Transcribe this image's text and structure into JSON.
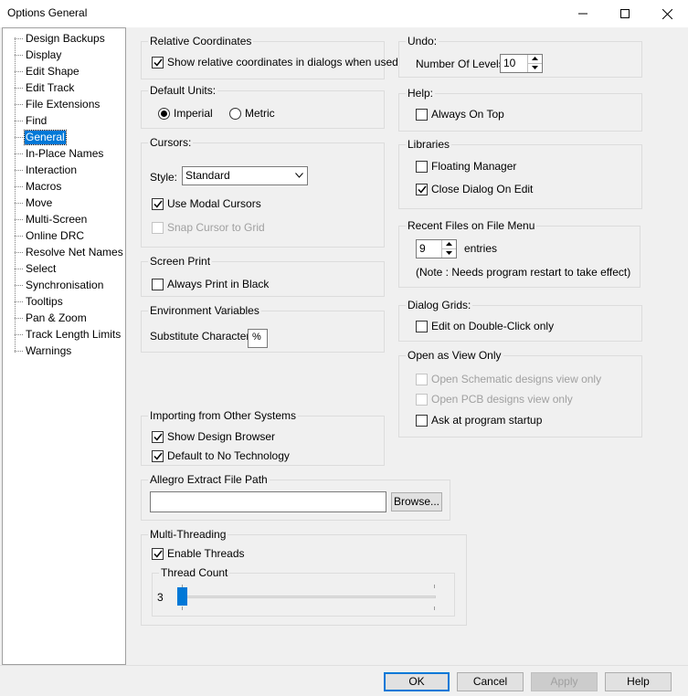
{
  "window": {
    "title": "Options  General"
  },
  "tree": {
    "items": [
      {
        "label": "Design Backups"
      },
      {
        "label": "Display"
      },
      {
        "label": "Edit Shape"
      },
      {
        "label": "Edit Track"
      },
      {
        "label": "File Extensions"
      },
      {
        "label": "Find"
      },
      {
        "label": "General",
        "selected": true
      },
      {
        "label": "In-Place Names"
      },
      {
        "label": "Interaction"
      },
      {
        "label": "Macros"
      },
      {
        "label": "Move"
      },
      {
        "label": "Multi-Screen"
      },
      {
        "label": "Online DRC"
      },
      {
        "label": "Resolve Net Names"
      },
      {
        "label": "Select"
      },
      {
        "label": "Synchronisation"
      },
      {
        "label": "Tooltips"
      },
      {
        "label": "Pan & Zoom"
      },
      {
        "label": "Track Length Limits"
      },
      {
        "label": "Warnings"
      }
    ]
  },
  "relative_coordinates": {
    "legend": "Relative Coordinates",
    "show_relative": {
      "label": "Show relative coordinates in dialogs when used",
      "checked": true
    }
  },
  "default_units": {
    "legend": "Default Units:",
    "imperial": {
      "label": "Imperial",
      "selected": true
    },
    "metric": {
      "label": "Metric",
      "selected": false
    }
  },
  "cursors": {
    "legend": "Cursors:",
    "style_label": "Style:",
    "style_value": "Standard",
    "use_modal": {
      "label": "Use Modal Cursors",
      "checked": true
    },
    "snap_to_grid": {
      "label": "Snap Cursor to Grid",
      "checked": false,
      "disabled": true
    }
  },
  "screen_print": {
    "legend": "Screen Print",
    "always_black": {
      "label": "Always Print in Black",
      "checked": false
    }
  },
  "environment_variables": {
    "legend": "Environment Variables",
    "substitute_label": "Substitute Character:",
    "substitute_value": "%"
  },
  "importing": {
    "legend": "Importing from Other Systems",
    "show_browser": {
      "label": "Show Design Browser",
      "checked": true
    },
    "no_technology": {
      "label": "Default to No Technology",
      "checked": true
    }
  },
  "allegro": {
    "legend": "Allegro Extract File Path",
    "path_value": "",
    "browse_label": "Browse..."
  },
  "multithreading": {
    "legend": "Multi-Threading",
    "enable": {
      "label": "Enable Threads",
      "checked": true
    },
    "thread_count_legend": "Thread Count",
    "thread_count_value": "3",
    "slider_fraction": 0.0
  },
  "undo": {
    "legend": "Undo:",
    "levels_label": "Number Of Levels:",
    "levels_value": "10"
  },
  "help": {
    "legend": "Help:",
    "always_on_top": {
      "label": "Always On Top",
      "checked": false
    }
  },
  "libraries": {
    "legend": "Libraries",
    "floating_manager": {
      "label": "Floating Manager",
      "checked": false
    },
    "close_on_edit": {
      "label": "Close Dialog On Edit",
      "checked": true
    }
  },
  "recent_files": {
    "legend": "Recent Files on File Menu",
    "count_value": "9",
    "entries_label": "entries",
    "note": "(Note : Needs program restart to take effect)"
  },
  "dialog_grids": {
    "legend": "Dialog Grids:",
    "edit_double_click": {
      "label": "Edit on Double-Click only",
      "checked": false
    }
  },
  "open_view_only": {
    "legend": "Open as View Only",
    "schematic": {
      "label": "Open Schematic designs view only",
      "checked": false,
      "disabled": true
    },
    "pcb": {
      "label": "Open PCB designs view only",
      "checked": false,
      "disabled": true
    },
    "ask_startup": {
      "label": "Ask at program startup",
      "checked": false
    }
  },
  "buttons": {
    "ok": "OK",
    "cancel": "Cancel",
    "apply": "Apply",
    "help": "Help"
  },
  "colors": {
    "accent": "#0078d7",
    "group_border": "#dcdcdc",
    "dialog_bg": "#f0f0f0"
  },
  "icons": {
    "minimize": "minimize-icon",
    "maximize": "maximize-icon",
    "close": "close-icon",
    "checkmark": "checkmark-icon",
    "dropdown": "chevron-down-icon",
    "spin_up": "spin-up-icon",
    "spin_down": "spin-down-icon"
  }
}
